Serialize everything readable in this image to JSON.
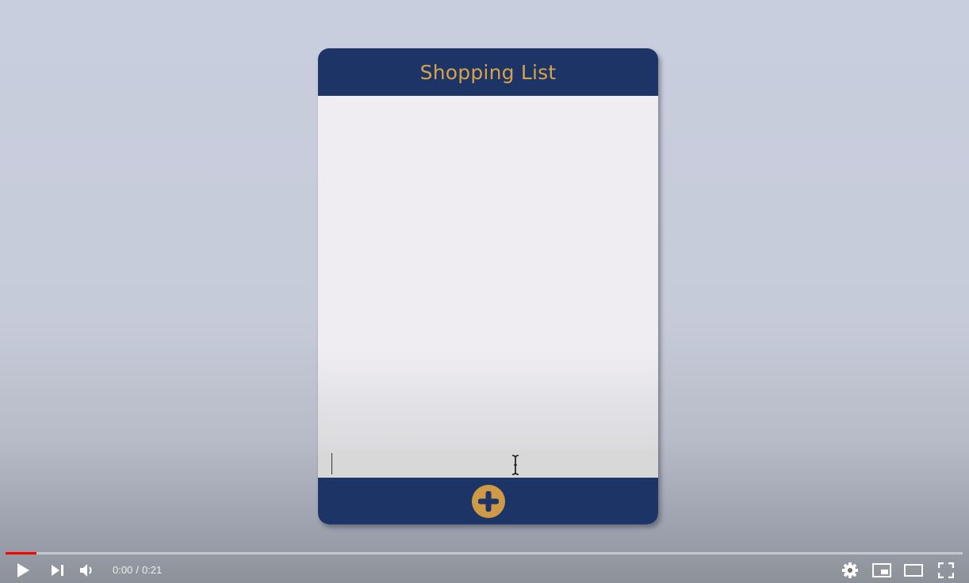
{
  "app": {
    "title": "Shopping List",
    "input_value": "",
    "colors": {
      "header_bg": "#1d3467",
      "accent": "#d8a24a",
      "list_bg": "#efedf2",
      "input_bg": "#d8d8d8"
    },
    "add_button_icon": "plus-icon"
  },
  "player": {
    "current_time": "0:00",
    "separator": "/",
    "duration": "0:21",
    "progress_fraction": 0.032,
    "progress_color": "#ff0000",
    "icons": [
      "play-icon",
      "next-icon",
      "volume-icon",
      "settings-icon",
      "miniplayer-icon",
      "theater-mode-icon",
      "fullscreen-icon"
    ]
  }
}
